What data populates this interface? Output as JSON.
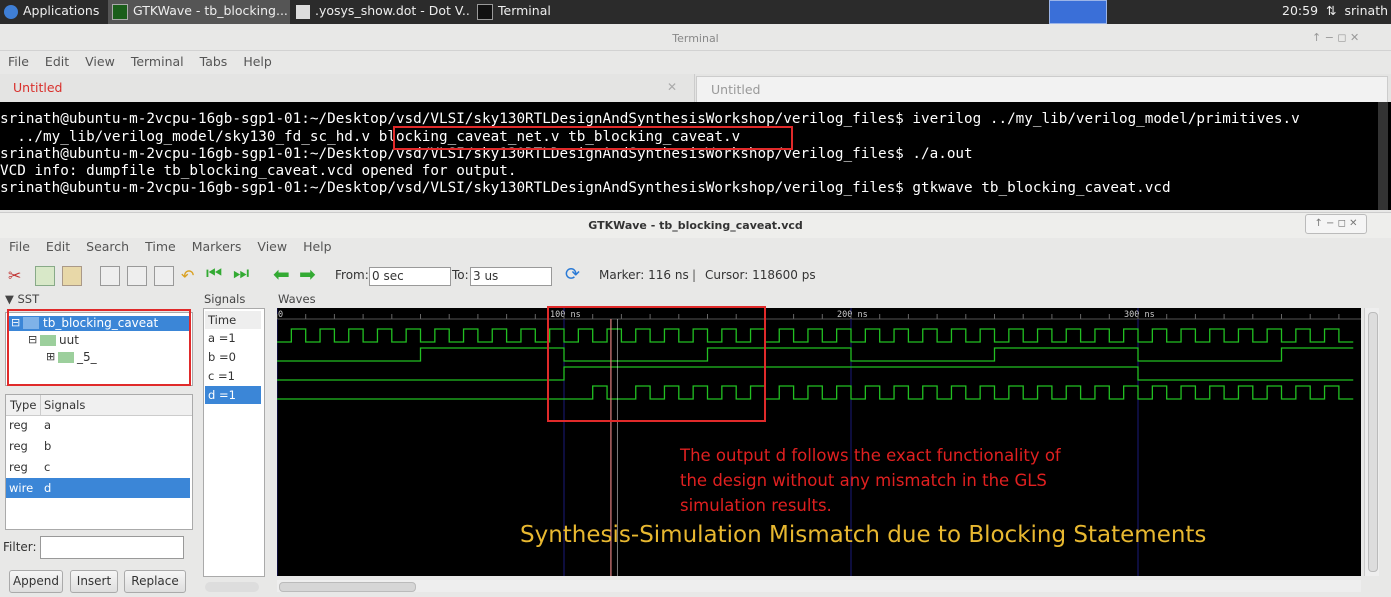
{
  "taskbar": {
    "applications": "Applications",
    "items": [
      "GTKWave - tb_blocking...",
      ".yosys_show.dot - Dot V...",
      "Terminal"
    ],
    "clock": "20:59",
    "user": "srinath"
  },
  "terminal": {
    "title": "Terminal",
    "menu": [
      "File",
      "Edit",
      "View",
      "Terminal",
      "Tabs",
      "Help"
    ],
    "tabs": [
      "Untitled",
      "Untitled"
    ],
    "lines": [
      "srinath@ubuntu-m-2vcpu-16gb-sgp1-01:~/Desktop/vsd/VLSI/sky130RTLDesignAndSynthesisWorkshop/verilog_files$ iverilog ../my_lib/verilog_model/primitives.v",
      "  ../my_lib/verilog_model/sky130_fd_sc_hd.v blocking_caveat_net.v tb_blocking_caveat.v",
      "srinath@ubuntu-m-2vcpu-16gb-sgp1-01:~/Desktop/vsd/VLSI/sky130RTLDesignAndSynthesisWorkshop/verilog_files$ ./a.out",
      "VCD info: dumpfile tb_blocking_caveat.vcd opened for output.",
      "srinath@ubuntu-m-2vcpu-16gb-sgp1-01:~/Desktop/vsd/VLSI/sky130RTLDesignAndSynthesisWorkshop/verilog_files$ gtkwave tb_blocking_caveat.vcd"
    ]
  },
  "gtkwave": {
    "title": "GTKWave - tb_blocking_caveat.vcd",
    "menu": [
      "File",
      "Edit",
      "Search",
      "Time",
      "Markers",
      "View",
      "Help"
    ],
    "from_label": "From:",
    "from_value": "0 sec",
    "to_label": "To:",
    "to_value": "3 us",
    "marker": "Marker: 116 ns",
    "cursor": "Cursor: 118600 ps",
    "sst_label": "▼ SST",
    "signals_label": "Signals",
    "waves_label": "Waves",
    "tree": [
      "tb_blocking_caveat",
      "uut",
      "_5_"
    ],
    "type_header": "Type",
    "signals_header": "Signals",
    "signal_list": [
      {
        "type": "reg",
        "name": "a"
      },
      {
        "type": "reg",
        "name": "b"
      },
      {
        "type": "reg",
        "name": "c"
      },
      {
        "type": "wire",
        "name": "d"
      }
    ],
    "filter_label": "Filter:",
    "buttons": [
      "Append",
      "Insert",
      "Replace"
    ],
    "time_label": "Time",
    "signal_values": [
      "a =1",
      "b =0",
      "c =1",
      "d =1"
    ],
    "ruler": [
      "0",
      "100 ns",
      "200 ns",
      "300 ns"
    ]
  },
  "waves": {
    "ns_range": [
      0,
      375
    ],
    "marker_ns": 116,
    "cursor_ns": 118.6,
    "a_period_ns": 10,
    "b_transitions_ns": [
      50,
      100,
      150,
      200,
      250,
      300,
      350
    ],
    "b_initial": 0,
    "c_transitions_ns": [
      100,
      300
    ],
    "c_initial": 0,
    "d_segments": [
      [
        0,
        0
      ],
      [
        110,
        1
      ],
      [
        115,
        0
      ],
      [
        125,
        1
      ],
      [
        130,
        0
      ],
      [
        135,
        1
      ],
      [
        140,
        0
      ],
      [
        145,
        1
      ],
      [
        150,
        0
      ],
      [
        155,
        1
      ],
      [
        160,
        0
      ],
      [
        165,
        1
      ],
      [
        170,
        0
      ],
      [
        175,
        1
      ],
      [
        180,
        0
      ],
      [
        185,
        1
      ],
      [
        190,
        0
      ],
      [
        195,
        1
      ],
      [
        200,
        0
      ],
      [
        205,
        1
      ],
      [
        210,
        0
      ],
      [
        215,
        1
      ],
      [
        220,
        0
      ],
      [
        225,
        1
      ],
      [
        230,
        0
      ],
      [
        235,
        1
      ],
      [
        240,
        0
      ],
      [
        245,
        1
      ],
      [
        250,
        0
      ],
      [
        255,
        1
      ],
      [
        260,
        0
      ],
      [
        265,
        1
      ],
      [
        270,
        0
      ],
      [
        275,
        1
      ],
      [
        280,
        0
      ],
      [
        285,
        1
      ],
      [
        290,
        0
      ],
      [
        295,
        1
      ],
      [
        300,
        0
      ],
      [
        305,
        1
      ],
      [
        310,
        0
      ],
      [
        315,
        1
      ],
      [
        320,
        0
      ],
      [
        325,
        1
      ],
      [
        330,
        0
      ],
      [
        335,
        1
      ],
      [
        340,
        0
      ],
      [
        345,
        1
      ],
      [
        350,
        0
      ],
      [
        355,
        1
      ],
      [
        360,
        0
      ],
      [
        365,
        1
      ],
      [
        370,
        0
      ]
    ],
    "wave_color": "#22c022",
    "marker_color": "#e08080"
  },
  "annotation": {
    "red_lines": [
      "The output d follows the exact functionality of",
      "the design without any mismatch in the GLS",
      "simulation results."
    ],
    "yellow": "Synthesis-Simulation Mismatch due to Blocking Statements"
  }
}
